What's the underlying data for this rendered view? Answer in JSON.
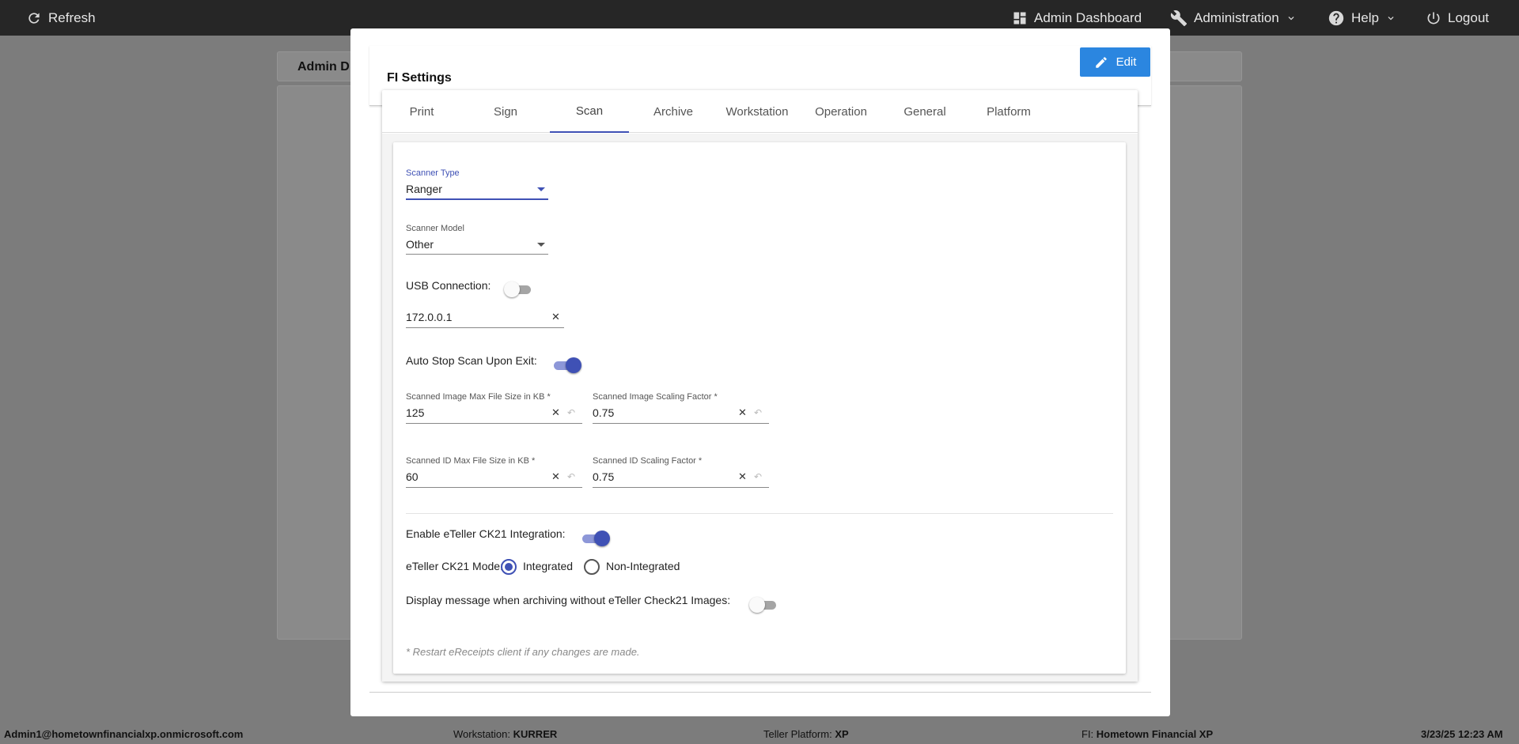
{
  "topbar": {
    "refresh": "Refresh",
    "admin_dashboard": "Admin Dashboard",
    "administration": "Administration",
    "help": "Help",
    "logout": "Logout"
  },
  "background": {
    "card_title": "Admin D"
  },
  "modal": {
    "title": "FI Settings",
    "edit_label": "Edit",
    "tabs": [
      "Print",
      "Sign",
      "Scan",
      "Archive",
      "Workstation",
      "Operation",
      "General",
      "Platform"
    ],
    "active_tab": "Scan"
  },
  "scan": {
    "scanner_type": {
      "label": "Scanner Type",
      "value": "Ranger"
    },
    "scanner_model": {
      "label": "Scanner Model",
      "value": "Other"
    },
    "usb_connection": {
      "label": "USB Connection:",
      "on": false
    },
    "ip_address": {
      "value": "172.0.0.1"
    },
    "auto_stop": {
      "label": "Auto Stop Scan Upon Exit:",
      "on": true
    },
    "image_max_size": {
      "label": "Scanned Image Max File Size in KB *",
      "value": "125"
    },
    "image_scaling": {
      "label": "Scanned Image Scaling Factor *",
      "value": "0.75"
    },
    "id_max_size": {
      "label": "Scanned ID Max File Size in KB *",
      "value": "60"
    },
    "id_scaling": {
      "label": "Scanned ID Scaling Factor *",
      "value": "0.75"
    },
    "ck21_integration": {
      "label": "Enable eTeller CK21 Integration:",
      "on": true
    },
    "ck21_mode": {
      "label": "eTeller CK21 Mode:",
      "options": [
        "Integrated",
        "Non-Integrated"
      ],
      "selected": "Integrated"
    },
    "display_message": {
      "label": "Display message when archiving without eTeller Check21 Images:",
      "on": false
    },
    "note": "* Restart eReceipts client if any changes are made."
  },
  "footer": {
    "user": "Admin1@hometownfinancialxp.onmicrosoft.com",
    "workstation_label": "Workstation:",
    "workstation_value": "KURRER",
    "platform_label": "Teller Platform:",
    "platform_value": "XP",
    "fi_label": "FI:",
    "fi_value": "Hometown Financial XP",
    "datetime": "3/23/25 12:23 AM"
  },
  "colors": {
    "accent": "#3f51b5",
    "edit_button": "#2b86e0",
    "topbar": "#262626"
  }
}
